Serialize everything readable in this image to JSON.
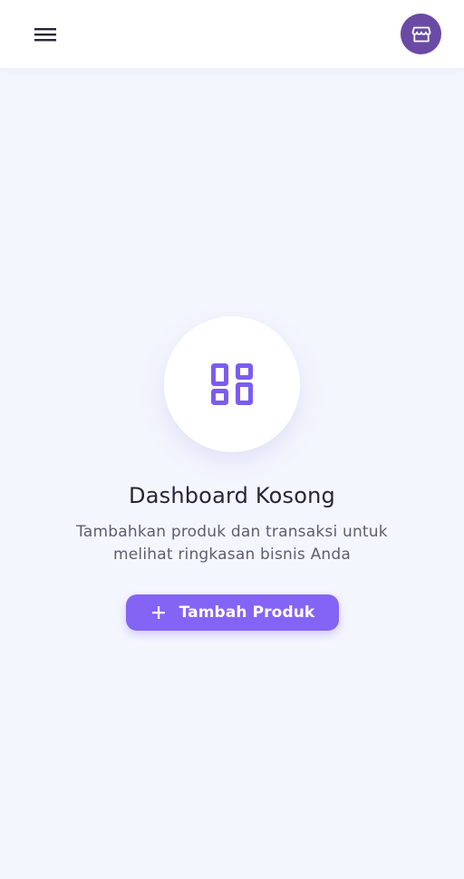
{
  "header": {
    "menu_icon": "menu-icon",
    "store_icon": "storefront-icon"
  },
  "empty_state": {
    "icon": "dashboard-icon",
    "title": "Dashboard Kosong",
    "description": "Tambahkan produk dan transaksi untuk melihat ringkasan bisnis Anda",
    "button_icon": "plus-icon",
    "button_label": "Tambah Produk"
  },
  "colors": {
    "background": "#f4f6fe",
    "accent": "#8464f4",
    "store_avatar": "#6b4aa6",
    "icon": "#7b5cf0"
  }
}
